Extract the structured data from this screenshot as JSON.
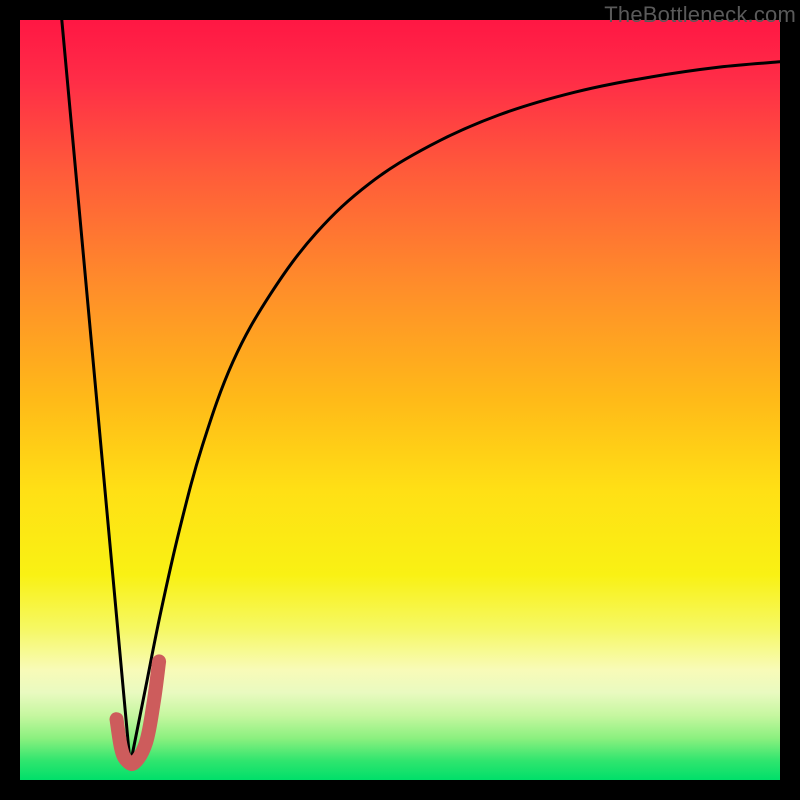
{
  "watermark": "TheBottleneck.com",
  "chart_data": {
    "type": "line",
    "title": "",
    "xlabel": "",
    "ylabel": "",
    "xlim": [
      0,
      100
    ],
    "ylim": [
      0,
      100
    ],
    "series": [
      {
        "name": "left-branch",
        "x": [
          5.5,
          14.5
        ],
        "y": [
          100,
          2
        ]
      },
      {
        "name": "right-branch",
        "x": [
          14.5,
          16.5,
          18.5,
          21,
          24,
          28,
          33,
          39,
          46,
          54,
          63,
          73,
          83,
          92,
          100
        ],
        "y": [
          2,
          12,
          22,
          33,
          44,
          55,
          64,
          72,
          78.5,
          83.5,
          87.5,
          90.5,
          92.5,
          93.8,
          94.5
        ]
      },
      {
        "name": "hook-overlay",
        "x": [
          12.7,
          13.3,
          14.0,
          15.1,
          16.6,
          17.6,
          18.3
        ],
        "y": [
          8.0,
          4.2,
          2.6,
          2.3,
          5.0,
          10.3,
          15.6
        ]
      }
    ],
    "gradient_stops": [
      {
        "offset": 0,
        "color": "#ff1744"
      },
      {
        "offset": 0.08,
        "color": "#ff2d47"
      },
      {
        "offset": 0.2,
        "color": "#ff5b3a"
      },
      {
        "offset": 0.35,
        "color": "#ff8d2a"
      },
      {
        "offset": 0.5,
        "color": "#ffba18"
      },
      {
        "offset": 0.62,
        "color": "#ffe015"
      },
      {
        "offset": 0.73,
        "color": "#f9f114"
      },
      {
        "offset": 0.8,
        "color": "#f6f862"
      },
      {
        "offset": 0.855,
        "color": "#f8fbb8"
      },
      {
        "offset": 0.885,
        "color": "#e9fac0"
      },
      {
        "offset": 0.915,
        "color": "#c6f7a0"
      },
      {
        "offset": 0.945,
        "color": "#8bf07f"
      },
      {
        "offset": 0.975,
        "color": "#2fe56e"
      },
      {
        "offset": 1.0,
        "color": "#00df6a"
      }
    ],
    "hook_color": "#cd5c5c",
    "curve_color": "#000000"
  }
}
